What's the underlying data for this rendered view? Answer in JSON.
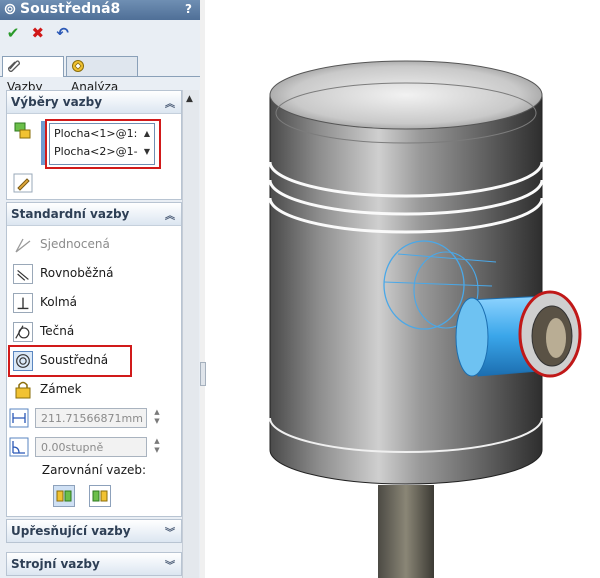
{
  "panel": {
    "title": "Soustředná8",
    "help": "?",
    "actions": {
      "ok": "✔",
      "cancel": "✖",
      "undo": "↶"
    },
    "tabs": [
      {
        "label": "Vazby"
      },
      {
        "label": "Analýza"
      }
    ]
  },
  "groups": {
    "selections": {
      "title": "Výběry vazby",
      "items": [
        "Plocha<1>@1:",
        "Plocha<2>@1-"
      ]
    },
    "standard": {
      "title": "Standardní vazby",
      "mates": [
        {
          "label": "Sjednocená",
          "enabled": false
        },
        {
          "label": "Rovnoběžná",
          "enabled": true
        },
        {
          "label": "Kolmá",
          "enabled": true
        },
        {
          "label": "Tečná",
          "enabled": true
        },
        {
          "label": "Soustředná",
          "enabled": true,
          "selected": true
        },
        {
          "label": "Zámek",
          "enabled": true
        }
      ],
      "distance": "211.71566871mm",
      "angle": "0.00stupně",
      "alignment_label": "Zarovnání vazeb:"
    },
    "advanced": {
      "title": "Upřesňující vazby"
    },
    "mechanical": {
      "title": "Strojní vazby"
    }
  },
  "colors": {
    "accent": "#d11a1a",
    "highlight": "#4aa8e8",
    "header": "#4f6f97"
  }
}
